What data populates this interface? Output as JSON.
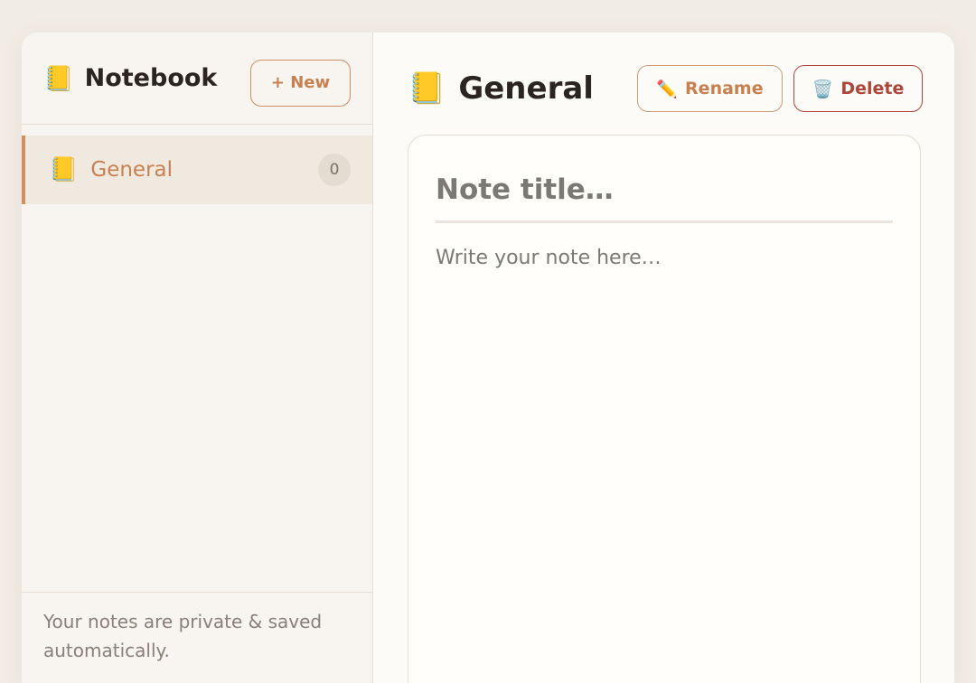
{
  "sidebar": {
    "brand_icon": "📒",
    "brand": "Notebook",
    "new_button": "+ New",
    "notebooks": [
      {
        "icon": "📒",
        "label": "General",
        "count": "0"
      }
    ],
    "footer": "Your notes are private & saved automatically."
  },
  "main": {
    "title_icon": "📒",
    "title": "General",
    "rename_icon": "✏️",
    "rename_label": "Rename",
    "delete_icon": "🗑️",
    "delete_label": "Delete",
    "editor": {
      "title_placeholder": "Note title…",
      "title_value": "",
      "body_placeholder": "Write your note here…",
      "body_value": ""
    }
  },
  "colors": {
    "accent": "#c9804f",
    "danger": "#b0453a",
    "background": "#f2ece6"
  }
}
